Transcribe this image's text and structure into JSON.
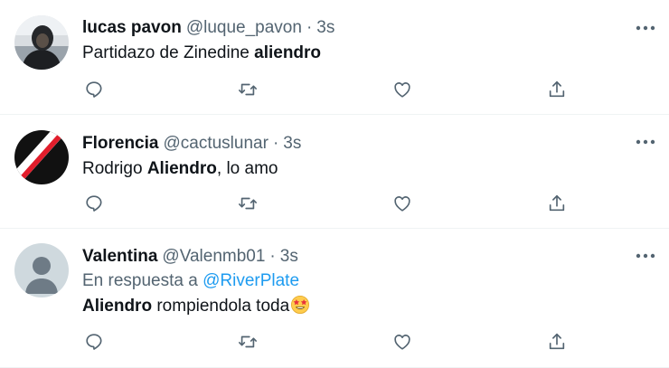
{
  "tweets": [
    {
      "name": "lucas pavon",
      "handle": "@luque_pavon",
      "separator": "·",
      "time": "3s",
      "text_before": "Partidazo de Zinedine ",
      "text_bold": "aliendro",
      "text_after": "",
      "avatar": "user-photo-dark"
    },
    {
      "name": "Florencia",
      "handle": "@cactuslunar",
      "separator": "·",
      "time": "3s",
      "text_before": "Rodrigo ",
      "text_bold": "Aliendro",
      "text_after": ", lo amo",
      "avatar": "river-plate-stripe"
    },
    {
      "name": "Valentina",
      "handle": "@Valenmb01",
      "separator": "·",
      "time": "3s",
      "reply_prefix": "En respuesta a",
      "reply_mention": "@RiverPlate",
      "text_bold": "Aliendro",
      "text_after": " rompiendola toda",
      "emoji": "star-struck-emoji",
      "avatar": "default-avatar"
    }
  ],
  "actions": [
    "reply-icon",
    "retweet-icon",
    "like-icon",
    "share-icon"
  ],
  "colors": {
    "text": "#0f1419",
    "secondary": "#536471",
    "link": "#1d9bf0",
    "divider": "#eff3f4"
  }
}
